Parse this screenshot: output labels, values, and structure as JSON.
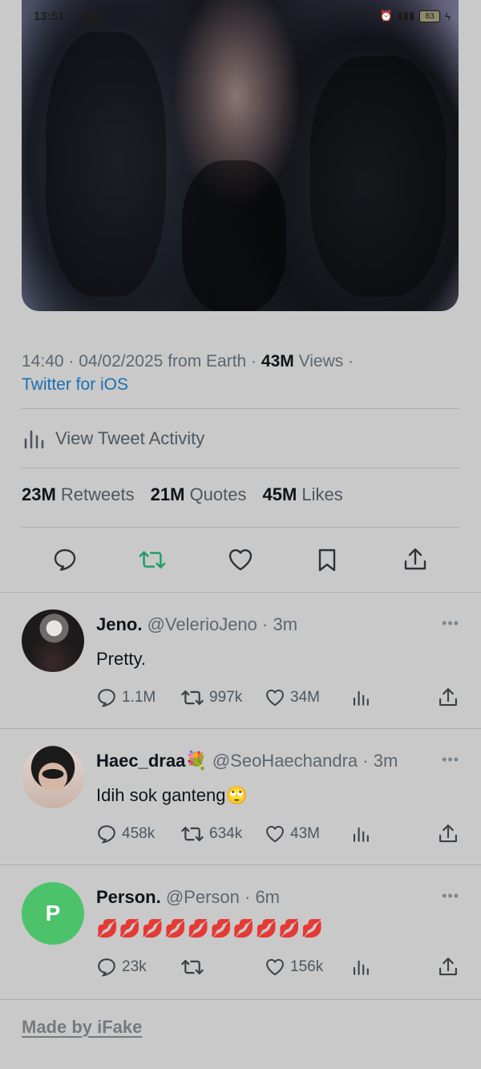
{
  "status_bar": {
    "time": "13:51",
    "battery": "83"
  },
  "tweet": {
    "time": "14:40",
    "date": "04/02/2025",
    "location": "from Earth",
    "views_count": "43M",
    "views_label": "Views",
    "client": "Twitter for iOS",
    "activity_label": "View Tweet Activity",
    "stats": [
      {
        "count": "23M",
        "label": "Retweets"
      },
      {
        "count": "21M",
        "label": "Quotes"
      },
      {
        "count": "45M",
        "label": "Likes"
      }
    ]
  },
  "replies": [
    {
      "name": "Jeno.",
      "handle": "@VelerioJeno",
      "time": "3m",
      "text": "Pretty.",
      "replies": "1.1M",
      "retweets": "997k",
      "likes": "34M"
    },
    {
      "name": "Haec_draa💐",
      "handle": "@SeoHaechandra",
      "time": "3m",
      "text": "Idih sok ganteng🙄",
      "replies": "458k",
      "retweets": "634k",
      "likes": "43M"
    },
    {
      "name": "Person.",
      "handle": "@Person",
      "time": "6m",
      "text": "💋💋💋💋💋💋💋💋💋💋",
      "replies": "23k",
      "retweets": "",
      "likes": "156k",
      "avatar_letter": "P"
    }
  ],
  "footer": {
    "made_by": "Made by iFake"
  },
  "colors": {
    "retweet_green": "#1e9e67",
    "link_blue": "#1d6fb0",
    "person_avatar": "#4cc36b"
  }
}
